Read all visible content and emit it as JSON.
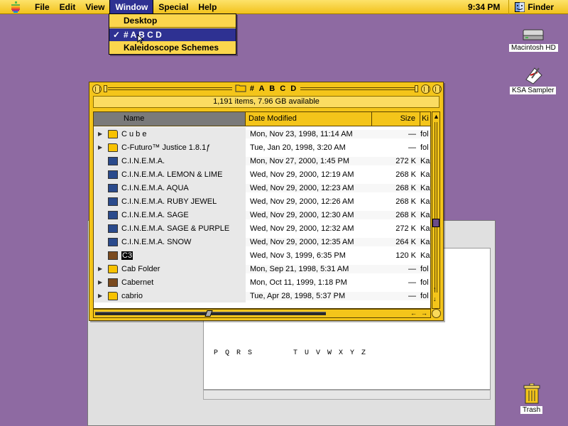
{
  "menubar": {
    "items": [
      "File",
      "Edit",
      "View",
      "Window",
      "Special",
      "Help"
    ],
    "active_item": "Window",
    "clock": "9:34 PM",
    "app_name": "Finder"
  },
  "window_menu": {
    "items": [
      {
        "label": "Desktop",
        "checked": false,
        "selected": false
      },
      {
        "label": "# A B C D",
        "checked": true,
        "selected": true
      },
      {
        "label": "Kaleidoscope Schemes",
        "checked": false,
        "selected": false
      }
    ],
    "check_glyph": "✓"
  },
  "desktop_icons": [
    {
      "label": "Macintosh HD",
      "icon": "hard-drive-icon"
    },
    {
      "label": "KSA Sampler",
      "icon": "document-icon"
    },
    {
      "label": "Trash",
      "icon": "trash-icon"
    }
  ],
  "back_window": {
    "chars_left": "P Q R S",
    "chars_right": "T U V W X Y Z"
  },
  "finder_window": {
    "title": "# A B C D",
    "info": "1,191 items, 7.96 GB available",
    "columns": {
      "name": "Name",
      "date": "Date Modified",
      "size": "Size",
      "kind": "Ki"
    },
    "rows": [
      {
        "name": "C u b e",
        "date": "Mon, Nov 23, 1998, 11:14 AM",
        "size": "—",
        "kind": "fol",
        "type": "folder",
        "expandable": true
      },
      {
        "name": "C-Futuro™ Justice 1.8.1ƒ",
        "date": "Tue, Jan 20, 1998, 3:20 AM",
        "size": "—",
        "kind": "fol",
        "type": "folder",
        "expandable": true
      },
      {
        "name": "C.I.N.E.M.A.",
        "date": "Mon, Nov 27, 2000, 1:45 PM",
        "size": "272 K",
        "kind": "Ka",
        "type": "theme",
        "expandable": false
      },
      {
        "name": "C.I.N.E.M.A.  LEMON & LIME",
        "date": "Wed, Nov 29, 2000, 12:19 AM",
        "size": "268 K",
        "kind": "Ka",
        "type": "theme",
        "expandable": false
      },
      {
        "name": "C.I.N.E.M.A. AQUA",
        "date": "Wed, Nov 29, 2000, 12:23 AM",
        "size": "268 K",
        "kind": "Ka",
        "type": "theme",
        "expandable": false
      },
      {
        "name": "C.I.N.E.M.A. RUBY JEWEL",
        "date": "Wed, Nov 29, 2000, 12:26 AM",
        "size": "268 K",
        "kind": "Ka",
        "type": "theme",
        "expandable": false
      },
      {
        "name": "C.I.N.E.M.A. SAGE",
        "date": "Wed, Nov 29, 2000, 12:30 AM",
        "size": "268 K",
        "kind": "Ka",
        "type": "theme",
        "expandable": false
      },
      {
        "name": "C.I.N.E.M.A. SAGE & PURPLE",
        "date": "Wed, Nov 29, 2000, 12:32 AM",
        "size": "272 K",
        "kind": "Ka",
        "type": "theme",
        "expandable": false
      },
      {
        "name": "C.I.N.E.M.A. SNOW",
        "date": "Wed, Nov 29, 2000, 12:35 AM",
        "size": "264 K",
        "kind": "Ka",
        "type": "theme",
        "expandable": false
      },
      {
        "name": "C3",
        "date": "Wed, Nov 3, 1999, 6:35 PM",
        "size": "120 K",
        "kind": "Ka",
        "type": "brown",
        "expandable": false,
        "highlight": true
      },
      {
        "name": "Cab Folder",
        "date": "Mon, Sep 21, 1998, 5:31 AM",
        "size": "—",
        "kind": "fol",
        "type": "folder",
        "expandable": true
      },
      {
        "name": "Cabernet",
        "date": "Mon, Oct 11, 1999, 1:18 PM",
        "size": "—",
        "kind": "fol",
        "type": "brown",
        "expandable": true
      },
      {
        "name": "cabrio",
        "date": "Tue, Apr 28, 1998, 5:37 PM",
        "size": "—",
        "kind": "fol",
        "type": "folder",
        "expandable": true
      }
    ]
  },
  "colors": {
    "desktop": "#8e6aa2",
    "theme_gold": "#f4c51a",
    "menu_highlight": "#2e3192"
  }
}
